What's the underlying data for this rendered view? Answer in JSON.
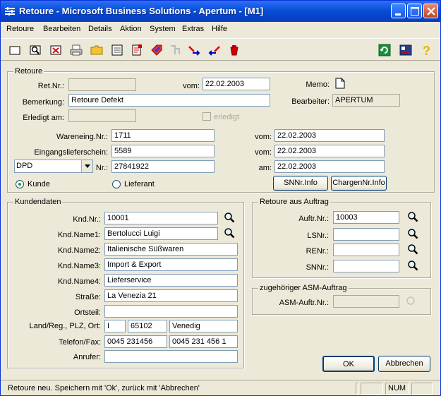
{
  "window": {
    "title": "Retoure - Microsoft Business Solutions - Apertum - [M1]"
  },
  "menu": [
    "Retoure",
    "Bearbeiten",
    "Details",
    "Aktion",
    "System",
    "Extras",
    "Hilfe"
  ],
  "toolbar": {
    "icons": [
      "new-icon",
      "search-doc-icon",
      "delete-icon",
      "print-icon",
      "open-folder-icon",
      "list-icon",
      "report-icon",
      "tag-icon",
      "filter-icon",
      "transfer-icon",
      "transfer-back-icon",
      "clear-icon",
      "refresh-icon",
      "info-panel-icon",
      "help-icon"
    ]
  },
  "retoure": {
    "legend": "Retoure",
    "retnr_label": "Ret.Nr.:",
    "retnr_value": "",
    "vom_label": "vom:",
    "vom_value": "22.02.2003",
    "memo_label": "Memo:",
    "bemerkung_label": "Bemerkung:",
    "bemerkung_value": "Retoure Defekt",
    "bearbeiter_label": "Bearbeiter:",
    "bearbeiter_value": "APERTUM",
    "erledigt_am_label": "Erledigt am:",
    "erledigt_am_value": "",
    "erledigt_label": "erledigt",
    "wareneing_label": "Wareneing.Nr.:",
    "wareneing_value": "1711",
    "wareneing_vom_label": "vom:",
    "wareneing_vom_value": "22.02.2003",
    "eingangslieferschein_label": "Eingangslieferschein:",
    "eingangslieferschein_value": "5589",
    "eingangslieferschein_vom_label": "vom:",
    "eingangslieferschein_vom_value": "22.02.2003",
    "carrier_value": "DPD",
    "nr_label": "Nr.:",
    "nr_value": "27841922",
    "am_label": "am:",
    "am_value": "22.02.2003",
    "radio_kunde": "Kunde",
    "radio_lieferant": "Lieferant",
    "snninfo_button": "SNNr.Info",
    "chargeninfo_button": "ChargenNr.Info"
  },
  "kunden": {
    "legend": "Kundendaten",
    "kndnr_label": "Knd.Nr.:",
    "kndnr_value": "10001",
    "name1_label": "Knd.Name1:",
    "name1_value": "Bertolucci Luigi",
    "name2_label": "Knd.Name2:",
    "name2_value": "Italienische Süßwaren",
    "name3_label": "Knd.Name3:",
    "name3_value": "Import & Export",
    "name4_label": "Knd.Name4:",
    "name4_value": "Lieferservice",
    "strasse_label": "Straße:",
    "strasse_value": "La Venezia 21",
    "ortsteil_label": "Ortsteil:",
    "ortsteil_value": "",
    "land_label": "Land/Reg., PLZ, Ort:",
    "land_value": "I",
    "plz_value": "65102",
    "ort_value": "Venedig",
    "telefon_label": "Telefon/Fax:",
    "telefon_value": "0045 231456",
    "fax_value": "0045 231 456 1",
    "anrufer_label": "Anrufer:",
    "anrufer_value": ""
  },
  "auftrag": {
    "legend": "Retoure aus Auftrag",
    "auftrnr_label": "Auftr.Nr.:",
    "auftrnr_value": "10003",
    "lsnr_label": "LSNr.:",
    "lsnr_value": "",
    "renr_label": "RENr.:",
    "renr_value": "",
    "snnr_label": "SNNr.:",
    "snnr_value": ""
  },
  "asm": {
    "legend": "zugehöriger ASM-Auftrag",
    "asmnr_label": "ASM-Auftr.Nr.:",
    "asmnr_value": ""
  },
  "buttons": {
    "ok": "OK",
    "abbrechen": "Abbrechen"
  },
  "status": {
    "message": "Retoure neu. Speichern mit 'Ok', zurück mit 'Abbrechen'",
    "num": "NUM"
  }
}
